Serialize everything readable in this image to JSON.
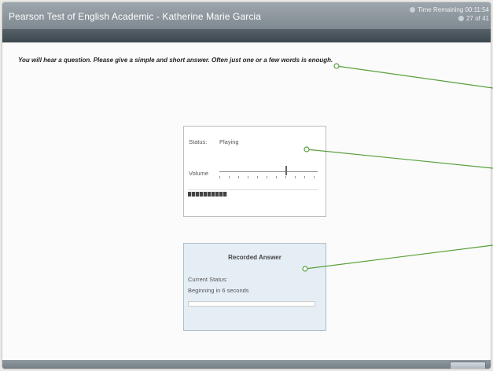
{
  "window": {
    "title": "Pearson Test of English Academic - Katherine Marie Garcia",
    "time_remaining": "Time Remaining 00:11:54",
    "progress": "27 of 41"
  },
  "instruction": "You will hear a question. Please give a simple and short answer. Often just one or a few words is enough.",
  "player": {
    "status_label": "Status:",
    "status_value": "Playing",
    "volume_label": "Volume",
    "volume_level": 0.68
  },
  "recorder": {
    "title": "Recorded Answer",
    "current_status_label": "Current Status:",
    "current_status_value": "Beginning in 6 seconds"
  },
  "colors": {
    "callout": "#5a9f3a",
    "titlebar": "#8e989e",
    "darkbar": "#46515a"
  }
}
